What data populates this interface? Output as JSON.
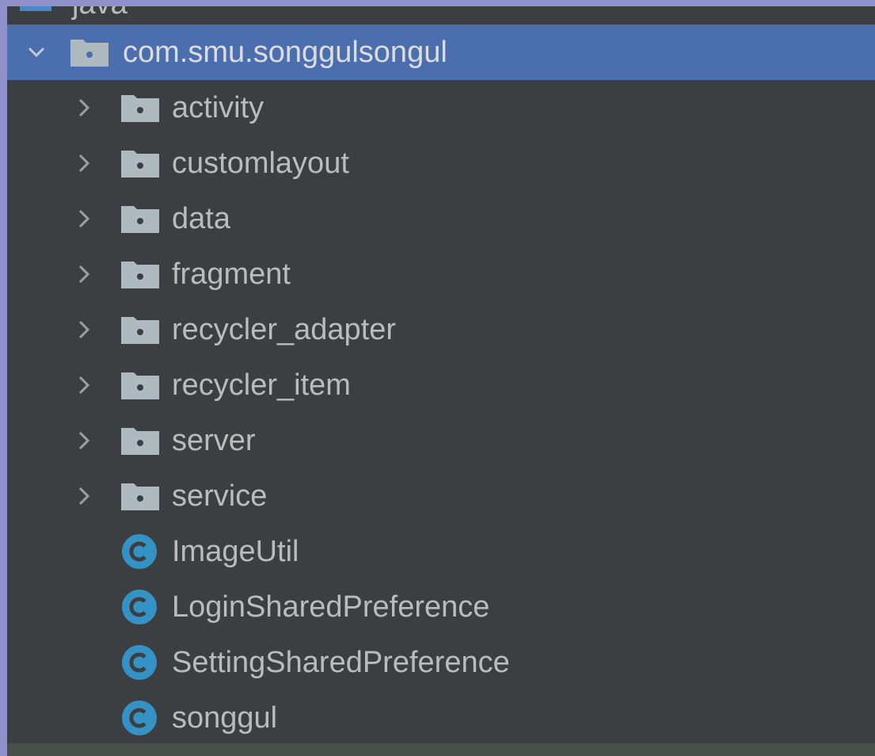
{
  "project_tree": {
    "partial_row": {
      "label": "java",
      "icon": "source-folder-icon"
    },
    "package_row": {
      "label": "com.smu.songgulsongul",
      "icon": "package-icon",
      "expanded": true,
      "selected": true
    },
    "packages": [
      {
        "label": "activity",
        "icon": "package-icon"
      },
      {
        "label": "customlayout",
        "icon": "package-icon"
      },
      {
        "label": "data",
        "icon": "package-icon"
      },
      {
        "label": "fragment",
        "icon": "package-icon"
      },
      {
        "label": "recycler_adapter",
        "icon": "package-icon"
      },
      {
        "label": "recycler_item",
        "icon": "package-icon"
      },
      {
        "label": "server",
        "icon": "package-icon"
      },
      {
        "label": "service",
        "icon": "package-icon"
      }
    ],
    "classes": [
      {
        "label": "ImageUtil",
        "icon": "class-icon"
      },
      {
        "label": "LoginSharedPreference",
        "icon": "class-icon"
      },
      {
        "label": "SettingSharedPreference",
        "icon": "class-icon"
      },
      {
        "label": "songgul",
        "icon": "class-icon"
      }
    ]
  },
  "colors": {
    "background": "#3c3f41",
    "selection": "#4b6eaf",
    "text": "#bbbbbb",
    "folder": "#aeb9c0",
    "class_icon": "#3592c4",
    "border": "#8f8fc9"
  }
}
